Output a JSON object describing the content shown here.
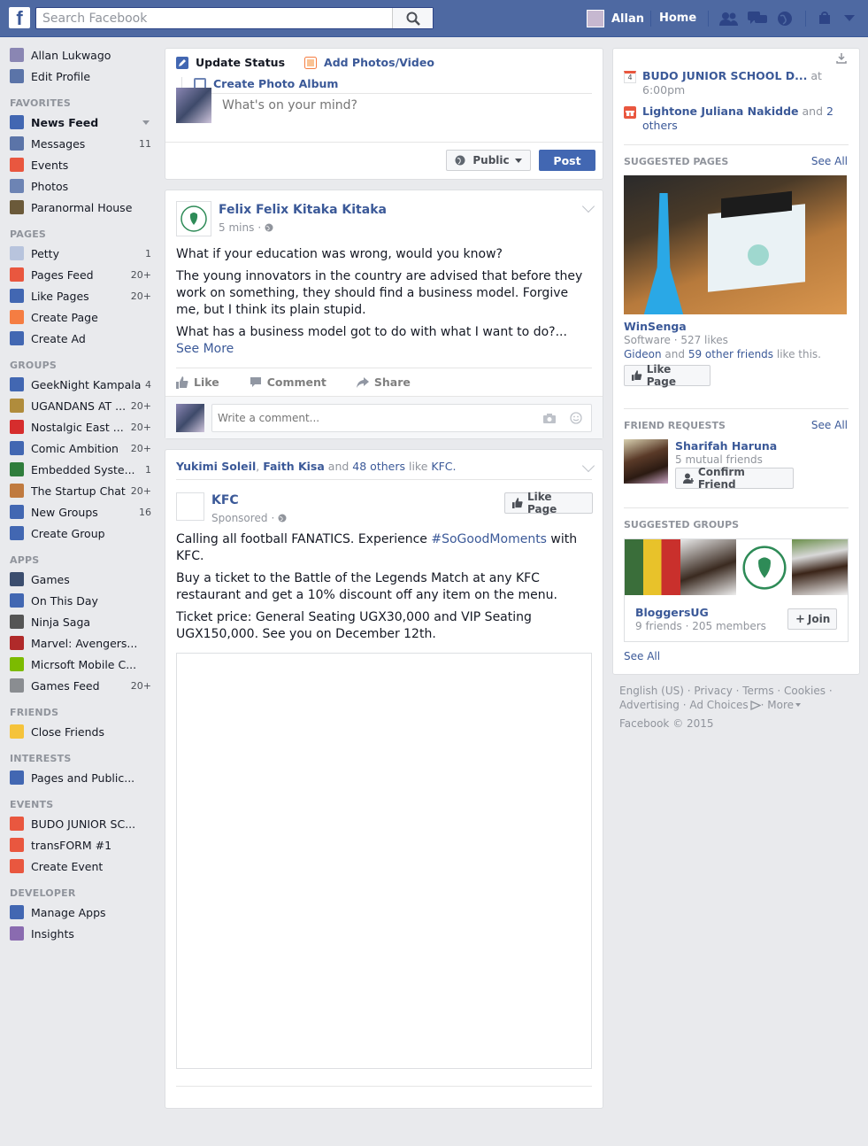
{
  "topbar": {
    "search_placeholder": "Search Facebook",
    "user_name": "Allan",
    "home_label": "Home"
  },
  "leftnav": {
    "profile": [
      {
        "label": "Allan Lukwago",
        "icon": "avatar",
        "color": "#8a86b3"
      },
      {
        "label": "Edit Profile",
        "icon": "pencil-icon",
        "color": "#5b74a8"
      }
    ],
    "favorites_heading": "FAVORITES",
    "favorites": [
      {
        "label": "News Feed",
        "icon": "news-feed-icon",
        "color": "#4267b2",
        "count": "",
        "bold": true
      },
      {
        "label": "Messages",
        "icon": "messages-icon",
        "color": "#5b74a8",
        "count": "11"
      },
      {
        "label": "Events",
        "icon": "calendar-icon",
        "color": "#e9573f",
        "count": ""
      },
      {
        "label": "Photos",
        "icon": "photos-icon",
        "color": "#6d84b4",
        "count": ""
      },
      {
        "label": "Paranormal House",
        "icon": "app-icon",
        "color": "#6b5a3a",
        "count": ""
      }
    ],
    "pages_heading": "PAGES",
    "pages": [
      {
        "label": "Petty",
        "icon": "page-icon",
        "color": "#b8c4dd",
        "count": "1"
      },
      {
        "label": "Pages Feed",
        "icon": "pages-feed-icon",
        "color": "#e9573f",
        "count": "20+"
      },
      {
        "label": "Like Pages",
        "icon": "thumbs-up-icon",
        "color": "#4267b2",
        "count": "20+"
      },
      {
        "label": "Create Page",
        "icon": "create-page-icon",
        "color": "#f57d42",
        "count": ""
      },
      {
        "label": "Create Ad",
        "icon": "chart-icon",
        "color": "#4267b2",
        "count": ""
      }
    ],
    "groups_heading": "GROUPS",
    "groups": [
      {
        "label": "GeekNight Kampala",
        "icon": "group-icon",
        "color": "#4267b2",
        "count": "4"
      },
      {
        "label": "UGANDANS AT ...",
        "icon": "trophy-icon",
        "color": "#b08c3c",
        "count": "20+"
      },
      {
        "label": "Nostalgic East ...",
        "icon": "cup-icon",
        "color": "#d62d2d",
        "count": "20+"
      },
      {
        "label": "Comic Ambition",
        "icon": "group-icon",
        "color": "#4267b2",
        "count": "20+"
      },
      {
        "label": "Embedded Syste...",
        "icon": "chip-icon",
        "color": "#2f7d3c",
        "count": "1"
      },
      {
        "label": "The Startup Chat",
        "icon": "head-icon",
        "color": "#c07a3f",
        "count": "20+"
      },
      {
        "label": "New Groups",
        "icon": "group-icon",
        "color": "#4267b2",
        "count": "16"
      },
      {
        "label": "Create Group",
        "icon": "plus-icon",
        "color": "#4267b2",
        "count": ""
      }
    ],
    "apps_heading": "APPS",
    "apps": [
      {
        "label": "Games",
        "icon": "games-icon",
        "color": "#3b4d6e",
        "count": ""
      },
      {
        "label": "On This Day",
        "icon": "clock-icon",
        "color": "#4267b2",
        "count": ""
      },
      {
        "label": "Ninja Saga",
        "icon": "ninja-icon",
        "color": "#555555",
        "count": ""
      },
      {
        "label": "Marvel: Avengers...",
        "icon": "avengers-icon",
        "color": "#b02a2a",
        "count": ""
      },
      {
        "label": "Micrsoft Mobile C...",
        "icon": "square-icon",
        "color": "#7cbb00",
        "count": ""
      },
      {
        "label": "Games Feed",
        "icon": "controller-icon",
        "color": "#8a8d91",
        "count": "20+"
      }
    ],
    "friends_heading": "FRIENDS",
    "friends": [
      {
        "label": "Close Friends",
        "icon": "star-icon",
        "color": "#f5c33b",
        "count": ""
      }
    ],
    "interests_heading": "INTERESTS",
    "interests": [
      {
        "label": "Pages and Public...",
        "icon": "rss-icon",
        "color": "#4267b2",
        "count": ""
      }
    ],
    "events_heading": "EVENTS",
    "events": [
      {
        "label": "BUDO JUNIOR SC...",
        "icon": "calendar-4-icon",
        "color": "#e9573f",
        "count": ""
      },
      {
        "label": "transFORM #1",
        "icon": "calendar-5-icon",
        "color": "#e9573f",
        "count": ""
      },
      {
        "label": "Create Event",
        "icon": "plus-calendar-icon",
        "color": "#e9573f",
        "count": ""
      }
    ],
    "developer_heading": "DEVELOPER",
    "developer": [
      {
        "label": "Manage Apps",
        "icon": "apps-icon",
        "color": "#4267b2",
        "count": ""
      },
      {
        "label": "Insights",
        "icon": "insights-icon",
        "color": "#8a6bb0",
        "count": ""
      }
    ]
  },
  "composer": {
    "update_status": "Update Status",
    "add_photos": "Add Photos/Video",
    "create_album": "Create Photo Album",
    "placeholder": "What's on your mind?",
    "privacy": "Public",
    "post_button": "Post"
  },
  "post1": {
    "author": "Felix Felix Kitaka Kitaka",
    "time": "5 mins",
    "paragraphs": [
      "What if your education was wrong, would you know?",
      "The young innovators in the country are advised that before they work on something, they should find a business model. Forgive me, but I think its plain stupid.",
      "What has a business model got to do with what I want to do?..."
    ],
    "see_more": "See More",
    "like": "Like",
    "comment": "Comment",
    "share": "Share",
    "comment_placeholder": "Write a comment..."
  },
  "post2": {
    "liked_by_1": "Yukimi Soleil",
    "liked_by_2": "Faith Kisa",
    "liked_and": "and",
    "liked_others": "48 others",
    "liked_like": "like",
    "liked_page": "KFC.",
    "page_name": "KFC",
    "sponsored": "Sponsored",
    "like_page": "Like Page",
    "p1_pre": "Calling all football FANATICS. Experience ",
    "p1_tag": "#SoGoodMoments",
    "p1_post": " with KFC.",
    "p2": "Buy a ticket to the Battle of the Legends Match at any KFC restaurant and get a 10% discount off any item on the menu.",
    "p3": "Ticket price: General Seating UGX30,000 and VIP Seating UGX150,000. See you on December 12th."
  },
  "right": {
    "event_title": "BUDO JUNIOR SCHOOL D...",
    "event_at": "at",
    "event_time": "6:00pm",
    "birthday_name": "Lightone Juliana Nakidde",
    "birthday_and": "and",
    "birthday_others": "2 others",
    "suggested_pages_heading": "SUGGESTED PAGES",
    "see_all": "See All",
    "page_name": "WinSenga",
    "page_meta": "Software · 527 likes",
    "page_friends_1": "Gideon",
    "page_friends_and": "and",
    "page_friends_2": "59 other friends",
    "page_friends_suffix": "like this.",
    "like_page": "Like Page",
    "friend_requests_heading": "FRIEND REQUESTS",
    "fr_name": "Sharifah Haruna",
    "fr_mutual": "5 mutual friends",
    "confirm_friend": "Confirm Friend",
    "suggested_groups_heading": "SUGGESTED GROUPS",
    "group_name": "BloggersUG",
    "group_meta": "9 friends · 205 members",
    "join": "Join",
    "see_all_bottom": "See All"
  },
  "footer": {
    "line1": "English (US) · Privacy · Terms · Cookies ·",
    "line2a": "Advertising · Ad Choices",
    "line2b": " · More",
    "copyright": "Facebook © 2015"
  }
}
